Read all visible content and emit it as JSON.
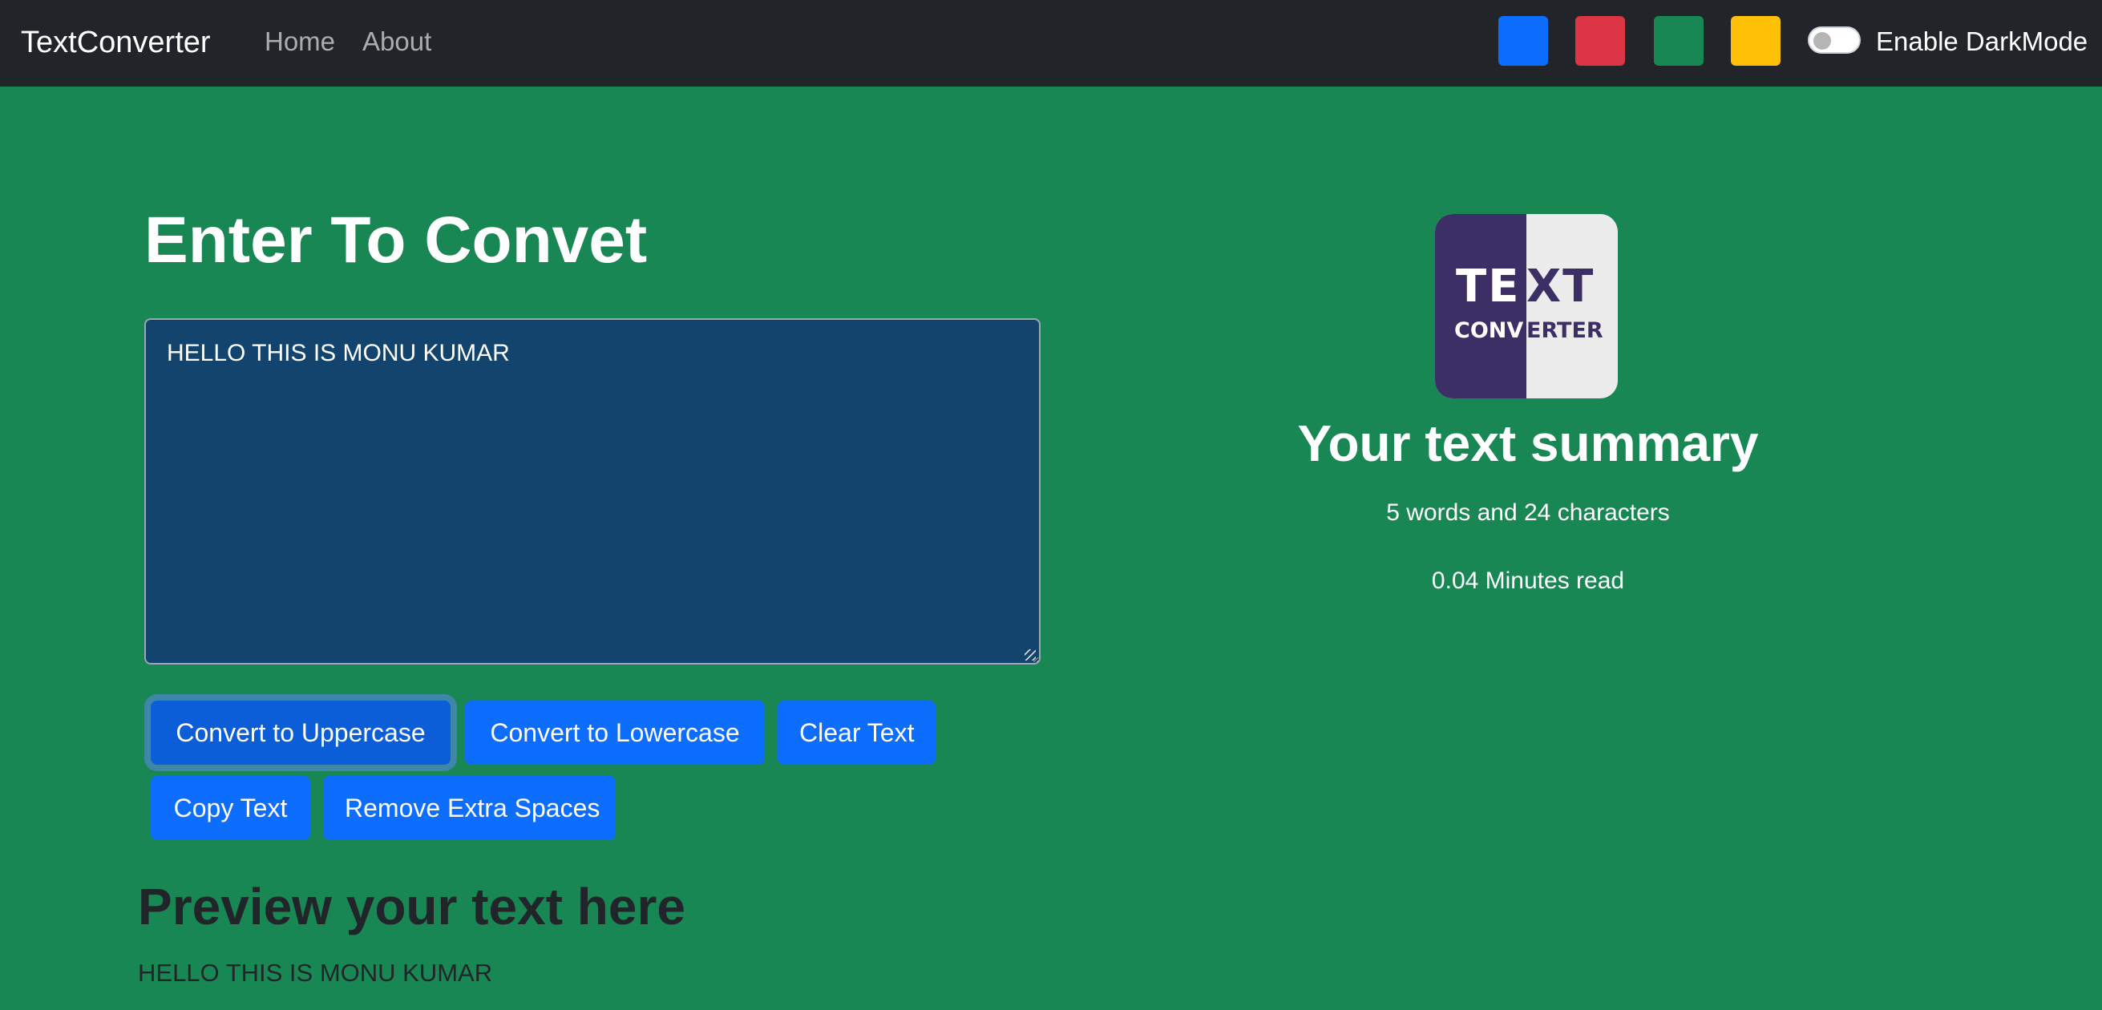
{
  "navbar": {
    "brand": "TextConverter",
    "links": [
      {
        "label": "Home"
      },
      {
        "label": "About"
      }
    ],
    "theme_swatches": [
      {
        "name": "blue",
        "color": "#0d6efd"
      },
      {
        "name": "red",
        "color": "#dc3545"
      },
      {
        "name": "green",
        "color": "#198754"
      },
      {
        "name": "yellow",
        "color": "#ffc107"
      }
    ],
    "dark_mode": {
      "label": "Enable DarkMode",
      "enabled": false
    }
  },
  "form": {
    "heading": "Enter To Convet",
    "text_value": "HELLO THIS IS MONU KUMAR",
    "buttons": {
      "uppercase": "Convert to Uppercase",
      "lowercase": "Convert to Lowercase",
      "clear": "Clear Text",
      "copy": "Copy Text",
      "remove_spaces": "Remove Extra Spaces"
    }
  },
  "preview": {
    "title": "Preview your text here",
    "text": "HELLO THIS IS MONU KUMAR"
  },
  "logo": {
    "title_left": "TE",
    "title_right": "XT",
    "sub_left": "CONV",
    "sub_right": "ERTER"
  },
  "summary": {
    "title": "Your text summary",
    "counts": "5 words and 24 characters",
    "read_time": "0.04 Minutes read"
  },
  "colors": {
    "page_background": "#198754",
    "navbar_background": "#212529",
    "textarea_background": "#13446e",
    "button_primary": "#0d6efd",
    "logo_dark": "#3b2f66",
    "logo_light": "#ececec"
  }
}
